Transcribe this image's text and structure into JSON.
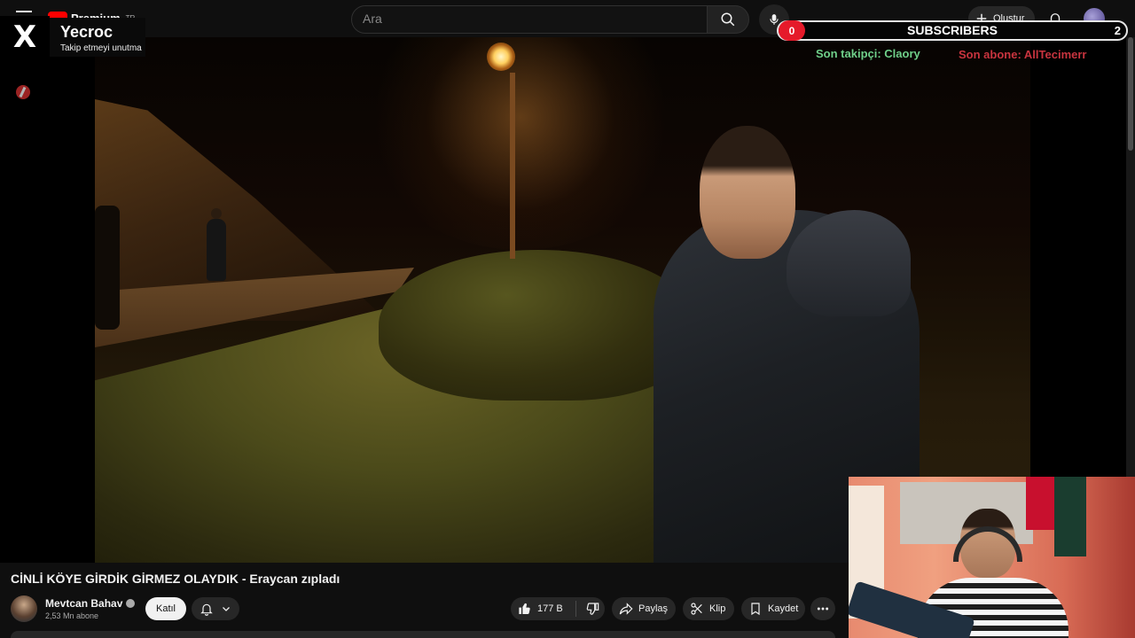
{
  "header": {
    "logo_text": "Premium",
    "logo_region": "TR",
    "search_placeholder": "Ara",
    "create_label": "Oluştur",
    "icons": [
      "menu-icon",
      "search-icon",
      "mic-icon",
      "plus-icon",
      "bell-icon",
      "avatar"
    ]
  },
  "overlay": {
    "x_logo": "X",
    "x_name": "Yecroc",
    "x_subtitle": "Takip etmeyi unutma",
    "subscribers_label": "SUBSCRIBERS",
    "subscribers_left": "0",
    "subscribers_right": "2",
    "last_follower": "Son takipçi: Claory",
    "last_subscriber": "Son abone: AllTecimerr",
    "colors": {
      "follower": "#6fd08a",
      "subscriber": "#c9343f",
      "counter": "#e51a2a"
    }
  },
  "video": {
    "title": "CİNLİ KÖYE GİRDİK GİRMEZ OLAYDIK - Eraycan zıpladı",
    "channel_name": "Mevtcan Bahav",
    "channel_subs": "2,53 Mn abone",
    "join_label": "Katıl",
    "likes": "177 B",
    "share_label": "Paylaş",
    "clip_label": "Klip",
    "save_label": "Kaydet"
  }
}
